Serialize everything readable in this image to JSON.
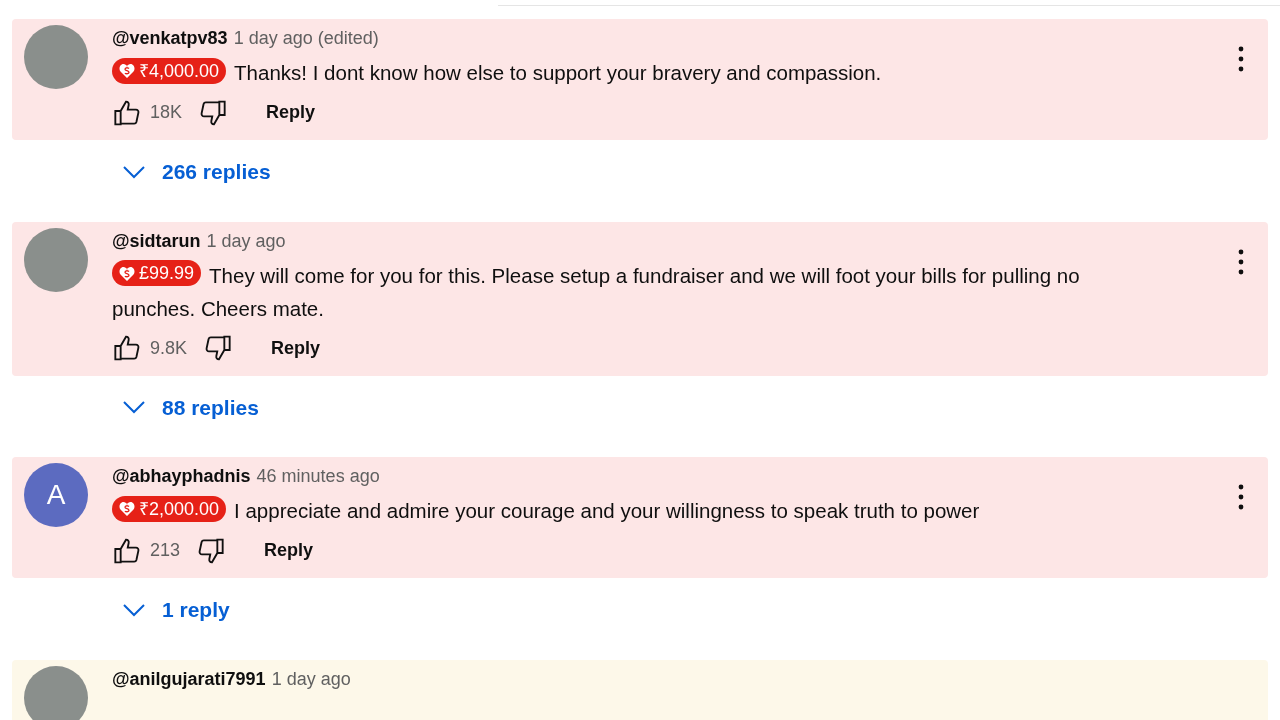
{
  "comments": [
    {
      "avatar": {
        "kind": "photo"
      },
      "author": "@venkatpv83",
      "time": "1 day ago (edited)",
      "amount": "₹4,000.00",
      "text": "Thanks! I dont know how else to support your bravery and compassion.",
      "likes": "18K",
      "reply_label": "Reply",
      "replies": "266 replies",
      "color": "#fde6e6"
    },
    {
      "avatar": {
        "kind": "photo"
      },
      "author": "@sidtarun",
      "time": "1 day ago",
      "amount": "£99.99",
      "text": "They will come for you for this. Please setup a fundraiser and we will foot your bills for pulling no punches. Cheers mate.",
      "likes": "9.8K",
      "reply_label": "Reply",
      "replies": "88 replies",
      "color": "#fde6e6"
    },
    {
      "avatar": {
        "kind": "letter",
        "letter": "A",
        "color": "#5c6bc0"
      },
      "author": "@abhayphadnis",
      "time": "46 minutes ago",
      "amount": "₹2,000.00",
      "text": "I appreciate and admire your courage and your willingness to speak truth to power",
      "likes": "213",
      "reply_label": "Reply",
      "replies": "1 reply",
      "color": "#fde6e6"
    },
    {
      "avatar": {
        "kind": "photo"
      },
      "author": "@anilgujarati7991",
      "time": "1 day ago",
      "color": "#fdf8e9"
    }
  ]
}
